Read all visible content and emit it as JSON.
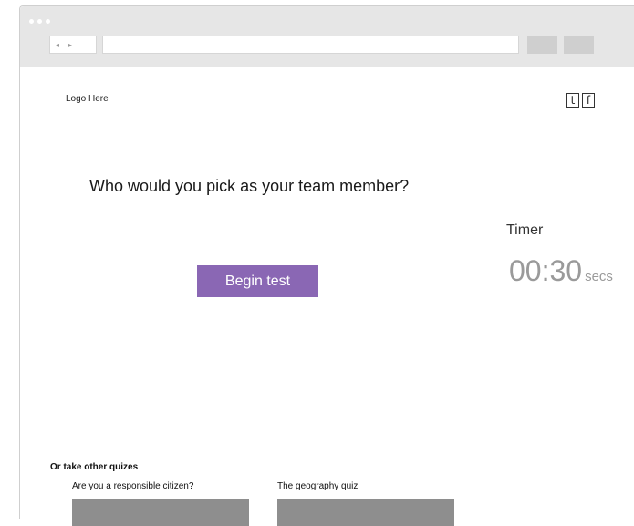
{
  "browser": {
    "back_icon": "◂",
    "forward_icon": "▸"
  },
  "header": {
    "logo_text": "Logo Here",
    "social": {
      "twitter": "t",
      "facebook": "f"
    }
  },
  "main": {
    "question": "Who would you pick as your team member?",
    "begin_button": "Begin test",
    "timer": {
      "label": "Timer",
      "value": "00:30",
      "unit": "secs"
    }
  },
  "other_quizzes": {
    "title": "Or take other quizes",
    "items": [
      {
        "title": "Are you a responsible citizen?"
      },
      {
        "title": "The geography quiz"
      }
    ]
  },
  "colors": {
    "button_bg": "#8a67b4",
    "timer_text": "#9a9a9a",
    "thumbnail": "#8e8e8e",
    "chrome": "#e6e6e6"
  }
}
